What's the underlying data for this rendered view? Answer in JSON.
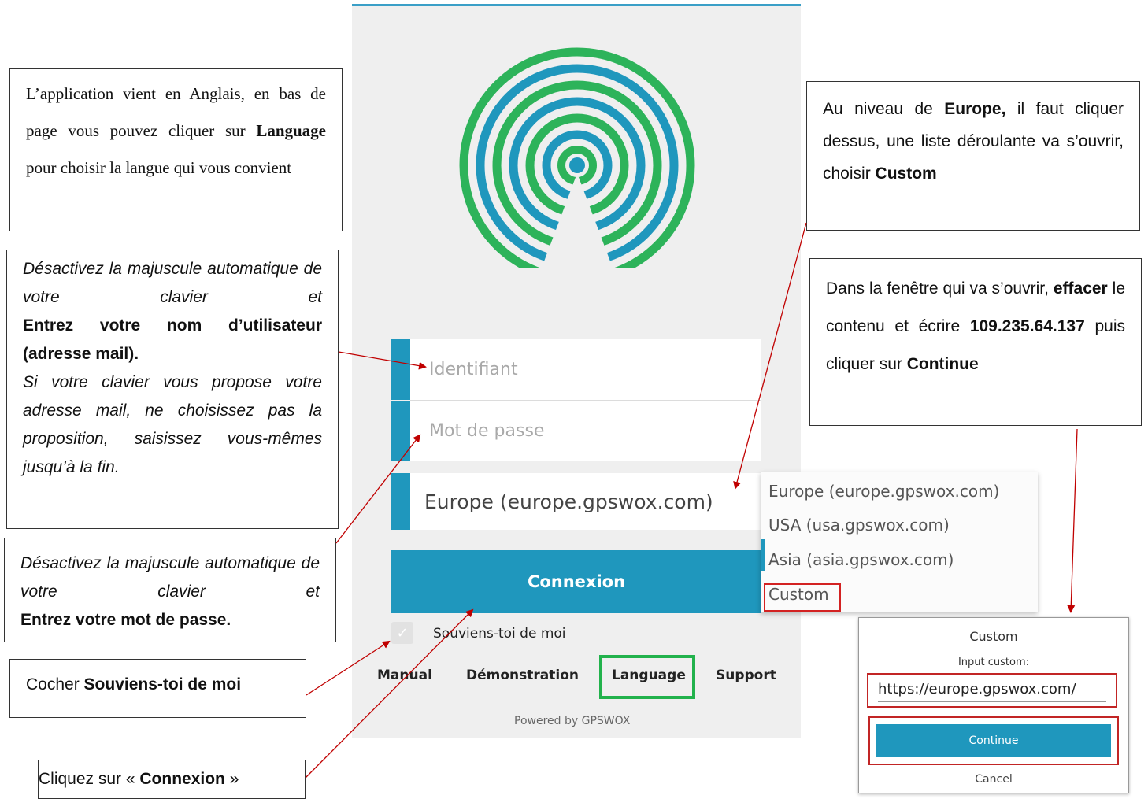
{
  "app": {
    "login_placeholder": "Identifiant",
    "password_placeholder": "Mot de passe",
    "server_selected": "Europe (europe.gpswox.com)",
    "login_button": "Connexion",
    "remember_label": "Souviens-toi de moi",
    "footer_links": [
      "Manual",
      "Démonstration",
      "Language",
      "Support"
    ],
    "powered_by": "Powered by GPSWOX",
    "colors": {
      "accent": "#1f97bd",
      "logo_green": "#2db35a",
      "highlight_green": "#22b24c",
      "highlight_red": "#d32222"
    }
  },
  "dropdown": {
    "options": [
      "Europe (europe.gpswox.com)",
      "USA (usa.gpswox.com)",
      "Asia (asia.gpswox.com)",
      "Custom"
    ]
  },
  "dialog": {
    "title": "Custom",
    "label": "Input custom:",
    "input_value": "https://europe.gpswox.com/",
    "continue_label": "Continue",
    "cancel_label": "Cancel"
  },
  "notes": {
    "language": {
      "part1": "L’application vient en Anglais, en bas de page vous pouvez cliquer sur ",
      "bold": "Language",
      "part2": " pour choisir la langue qui vous convient"
    },
    "username": {
      "line1": "Désactivez la majuscule automatique de votre clavier et",
      "bold": "Entrez votre nom d’utilisateur (adresse mail).",
      "line3": "Si votre clavier vous propose votre adresse mail, ne choisissez pas la proposition, saisissez vous-mêmes jusqu’à la fin."
    },
    "password": {
      "line1": "Désactivez la majuscule automatique de votre clavier et",
      "bold": "Entrez votre mot de passe."
    },
    "remember": {
      "prefix": "Cocher ",
      "bold": "Souviens-toi de moi"
    },
    "connexion": {
      "prefix": "Cliquez sur « ",
      "bold": "Connexion",
      "suffix": " »"
    },
    "europe": {
      "p1": "Au niveau de ",
      "b1": "Europe,",
      "p2": " il faut cliquer dessus, une liste déroulante va s’ouvrir, choisir ",
      "b2": "Custom"
    },
    "custom": {
      "p1": "Dans la fenêtre qui va s’ouvrir, ",
      "b1": "effacer",
      "p2": " le contenu et écrire ",
      "b2": "109.235.64.137",
      "p3": " puis cliquer sur ",
      "b3": "Continue"
    }
  }
}
